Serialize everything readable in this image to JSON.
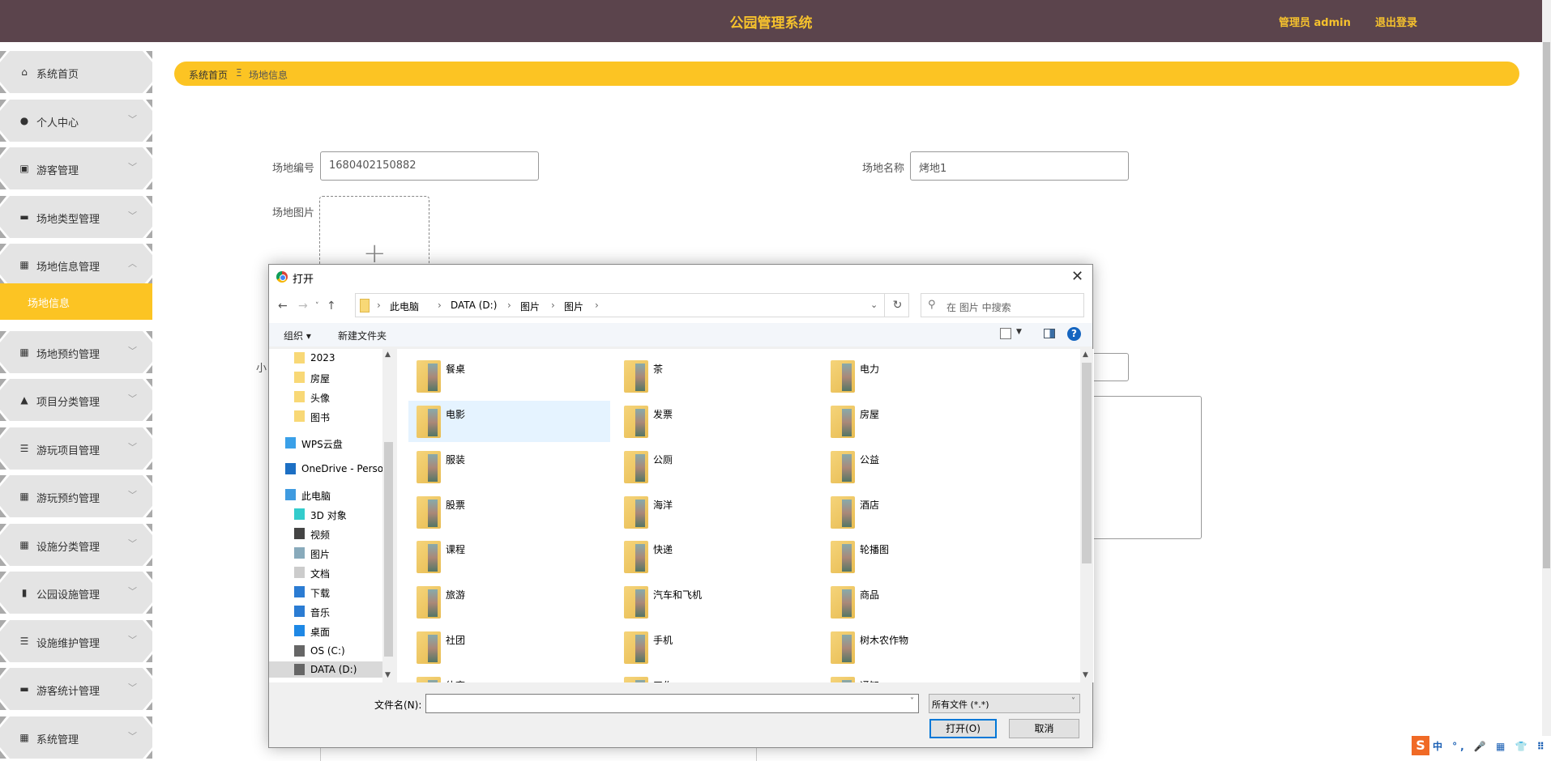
{
  "header": {
    "title": "公园管理系统",
    "user": "管理员 admin",
    "logout": "退出登录"
  },
  "sidebar": {
    "items": [
      {
        "label": "系统首页",
        "icon": "home-icon",
        "glyph": "⌂"
      },
      {
        "label": "个人中心",
        "icon": "user-icon",
        "glyph": "●"
      },
      {
        "label": "游客管理",
        "icon": "clipboard-icon",
        "glyph": "▣"
      },
      {
        "label": "场地类型管理",
        "icon": "monitor-icon",
        "glyph": "▬"
      },
      {
        "label": "场地信息管理",
        "icon": "grid-icon",
        "glyph": "▦",
        "expanded": true
      },
      {
        "label": "场地预约管理",
        "icon": "grid-icon",
        "glyph": "▦"
      },
      {
        "label": "项目分类管理",
        "icon": "stamp-icon",
        "glyph": "▲"
      },
      {
        "label": "游玩项目管理",
        "icon": "list-icon",
        "glyph": "☰"
      },
      {
        "label": "游玩预约管理",
        "icon": "grid-icon",
        "glyph": "▦"
      },
      {
        "label": "设施分类管理",
        "icon": "grid-icon",
        "glyph": "▦"
      },
      {
        "label": "公园设施管理",
        "icon": "bar-chart-icon",
        "glyph": "▮"
      },
      {
        "label": "设施维护管理",
        "icon": "sliders-icon",
        "glyph": "☰"
      },
      {
        "label": "游客统计管理",
        "icon": "briefcase-icon",
        "glyph": "▬"
      },
      {
        "label": "系统管理",
        "icon": "grid-icon",
        "glyph": "▦"
      }
    ],
    "active_sub": "场地信息"
  },
  "breadcrumb": {
    "home": "系统首页",
    "separator": "Ξ",
    "current": "场地信息"
  },
  "form": {
    "code_label": "场地编号",
    "code_value": "1680402150882",
    "name_label": "场地名称",
    "name_value": "烤地1",
    "image_label": "场地图片",
    "upload_plus": "+",
    "partial_label": "小"
  },
  "dialog": {
    "title": "打开",
    "close": "✕",
    "path": [
      "此电脑",
      "DATA (D:)",
      "图片",
      "图片"
    ],
    "search_placeholder": "在 图片 中搜索",
    "organize": "组织 ▾",
    "new_folder": "新建文件夹",
    "help": "?",
    "nav": [
      {
        "label": "2023",
        "icon": "folder-icon",
        "indent": true
      },
      {
        "label": "房屋",
        "icon": "folder-icon",
        "indent": true
      },
      {
        "label": "头像",
        "icon": "folder-icon",
        "indent": true
      },
      {
        "label": "图书",
        "icon": "folder-icon",
        "indent": true
      },
      {
        "label": "WPS云盘",
        "icon": "cloud-icon",
        "indent": false
      },
      {
        "label": "OneDrive - Personal",
        "icon": "onedrive-icon",
        "indent": false
      },
      {
        "label": "此电脑",
        "icon": "computer-icon",
        "indent": false
      },
      {
        "label": "3D 对象",
        "icon": "cube-icon",
        "indent": true
      },
      {
        "label": "视频",
        "icon": "video-icon",
        "indent": true
      },
      {
        "label": "图片",
        "icon": "picture-icon",
        "indent": true
      },
      {
        "label": "文档",
        "icon": "document-icon",
        "indent": true
      },
      {
        "label": "下载",
        "icon": "download-icon",
        "indent": true
      },
      {
        "label": "音乐",
        "icon": "music-icon",
        "indent": true
      },
      {
        "label": "桌面",
        "icon": "desktop-icon",
        "indent": true
      },
      {
        "label": "OS (C:)",
        "icon": "drive-icon",
        "indent": true
      },
      {
        "label": "DATA (D:)",
        "icon": "drive-icon",
        "indent": true,
        "selected": true
      }
    ],
    "folders": [
      "餐桌",
      "茶",
      "电力",
      "电影",
      "发票",
      "房屋",
      "服装",
      "公厕",
      "公益",
      "股票",
      "海洋",
      "酒店",
      "课程",
      "快递",
      "轮播图",
      "旅游",
      "汽车和飞机",
      "商品",
      "社团",
      "手机",
      "树木农作物",
      "体育",
      "工作",
      "通知"
    ],
    "hovered_folder": "电影",
    "filename_label": "文件名(N):",
    "filename_value": "",
    "filter": "所有文件 (*.*)",
    "open": "打开(O)",
    "cancel": "取消"
  },
  "ime": {
    "logo": "S",
    "tray": "中 °, 🎤 ▦ 👕 ⠿"
  },
  "colors": {
    "header": "#5b444c",
    "accent": "#fcc423",
    "sidebar_item": "#e4e4e4"
  }
}
